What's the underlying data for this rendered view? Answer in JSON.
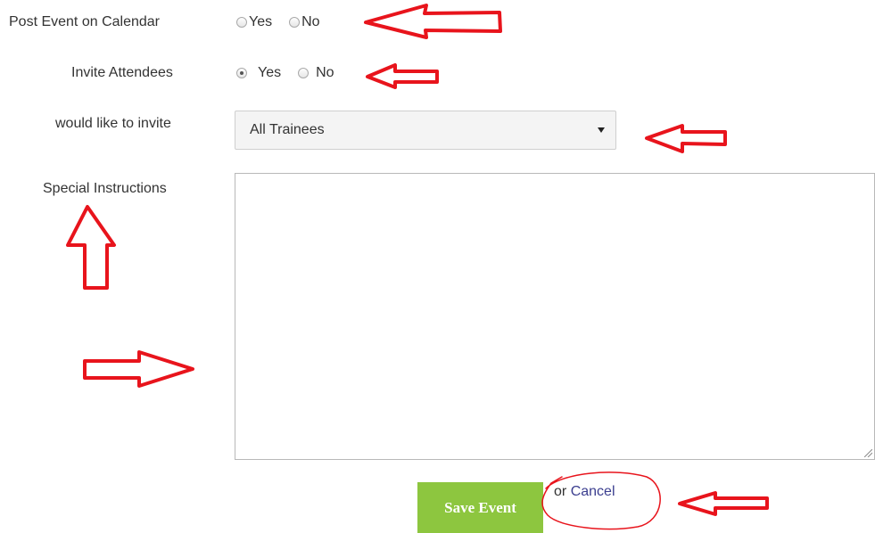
{
  "form": {
    "post_event": {
      "label": "Post Event on Calendar",
      "options": [
        {
          "label": "Yes",
          "checked": false
        },
        {
          "label": "No",
          "checked": false
        }
      ]
    },
    "invite_attendees": {
      "label": "Invite Attendees",
      "options": [
        {
          "label": "Yes",
          "checked": true
        },
        {
          "label": "No",
          "checked": false
        }
      ]
    },
    "invite_target": {
      "label": "would like to invite",
      "selected": "All Trainees"
    },
    "special_instructions": {
      "label": "Special Instructions",
      "value": ""
    },
    "actions": {
      "save_label": "Save Event",
      "or_text": "or",
      "cancel_label": "Cancel"
    }
  },
  "colors": {
    "save_button": "#8dc63f",
    "cancel_link": "#3b3e8f",
    "annotation": "#e8141c"
  },
  "annotations": {
    "arrow_icons": [
      "left-arrow-icon",
      "left-arrow-icon",
      "left-arrow-icon",
      "up-arrow-icon",
      "right-arrow-icon",
      "left-arrow-icon"
    ],
    "circle_icon": "cancel-circle-icon"
  }
}
